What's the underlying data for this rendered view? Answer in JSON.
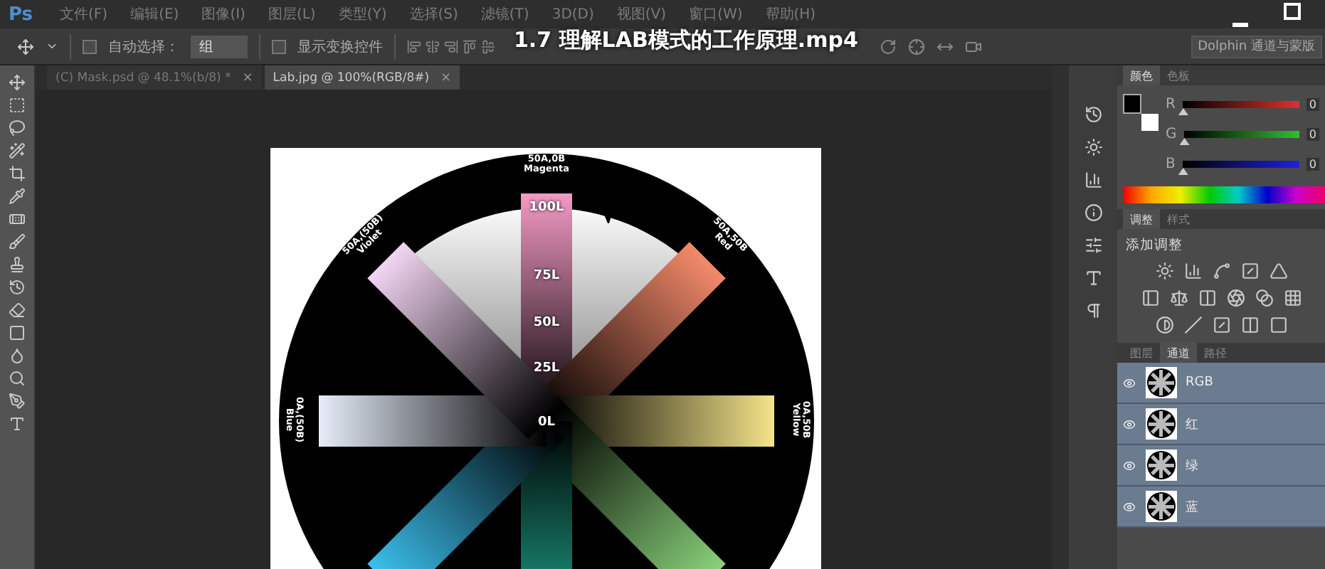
{
  "app_logo": "Ps",
  "menu": [
    "文件(F)",
    "编辑(E)",
    "图像(I)",
    "图层(L)",
    "类型(Y)",
    "选择(S)",
    "滤镜(T)",
    "3D(D)",
    "视图(V)",
    "窗口(W)",
    "帮助(H)"
  ],
  "video_title": "1.7 理解LAB模式的工作原理.mp4",
  "options_bar": {
    "auto_select": {
      "label": "自动选择：",
      "checked": false
    },
    "target": {
      "value": "组"
    },
    "show_transform": {
      "label": "显示变换控件",
      "checked": false
    },
    "workspace": "Dolphin 通道与蒙版"
  },
  "document_tabs": [
    {
      "label": "(C) Mask.psd @ 48.1%(b/8) *",
      "close": "×",
      "selected": false
    },
    {
      "label": "Lab.jpg @ 100%(RGB/8#)",
      "close": "×",
      "selected": true
    }
  ],
  "image": {
    "rim_labels": [
      {
        "code": "50A,0B",
        "name": "Magenta"
      },
      {
        "code": "50A,50B",
        "name": "Red"
      },
      {
        "code": "50A,(50B)",
        "name": "Violet"
      },
      {
        "code": "0A,(50B)",
        "name": "Blue"
      },
      {
        "code": "0A,50B",
        "name": "Yellow"
      }
    ],
    "scale_labels": [
      "100L",
      "75L",
      "50L",
      "25L",
      "0L"
    ]
  },
  "color_panel": {
    "tabs": [
      {
        "label": "颜色",
        "selected": true
      },
      {
        "label": "色板",
        "selected": false
      }
    ],
    "sliders": [
      {
        "label": "R",
        "level": 0,
        "value": "0"
      },
      {
        "label": "G",
        "level": 0,
        "value": "0"
      },
      {
        "label": "B",
        "level": 0,
        "value": "0"
      }
    ]
  },
  "adjust_panel": {
    "tabs": [
      {
        "label": "调整",
        "selected": true
      },
      {
        "label": "样式",
        "selected": false
      }
    ],
    "heading": "添加调整"
  },
  "channels_panel": {
    "tabs": [
      {
        "label": "图层",
        "selected": false
      },
      {
        "label": "通道",
        "selected": true
      },
      {
        "label": "路径",
        "selected": false
      }
    ],
    "rows": [
      {
        "name": "RGB",
        "visible": true,
        "selected": true
      },
      {
        "name": "红",
        "visible": true,
        "selected": true
      },
      {
        "name": "绿",
        "visible": true,
        "selected": true
      },
      {
        "name": "蓝",
        "visible": true,
        "selected": true
      }
    ]
  }
}
